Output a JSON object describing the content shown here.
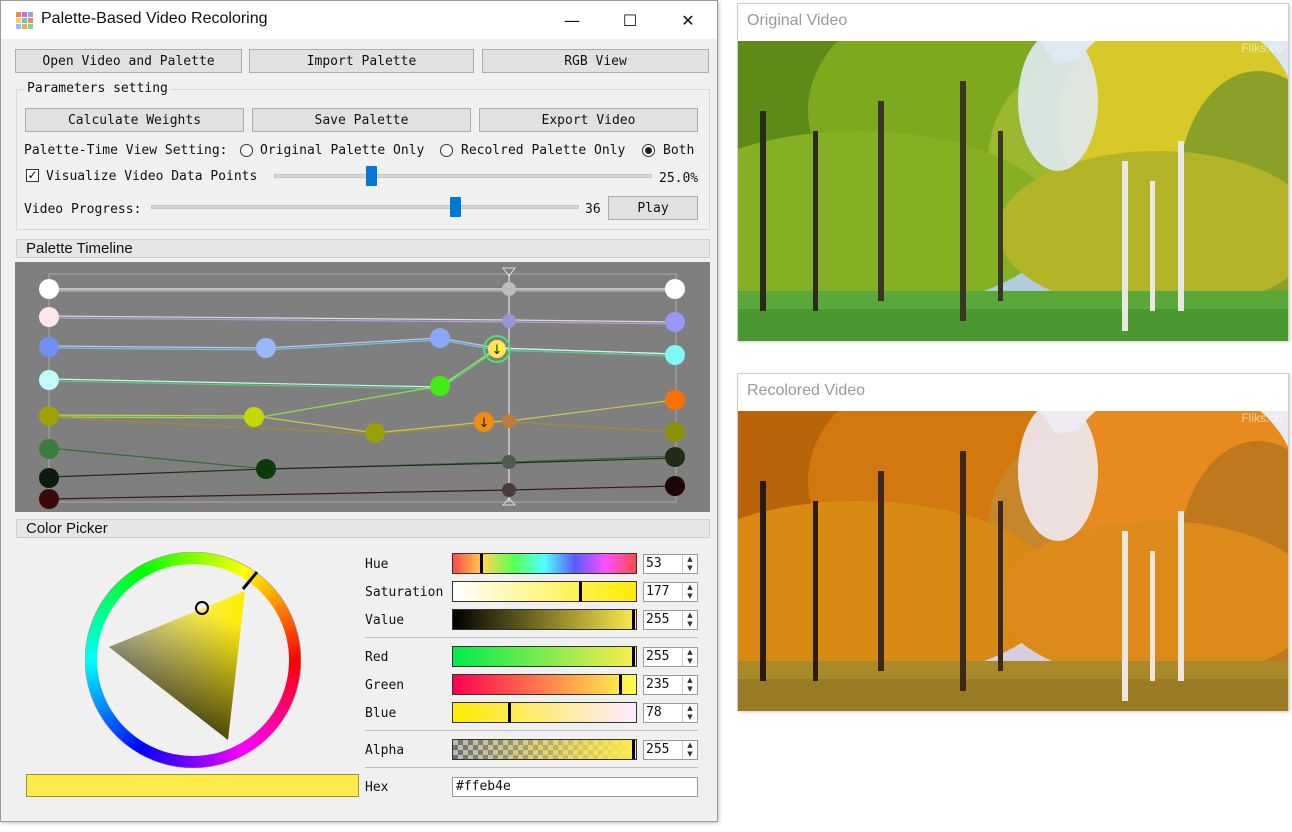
{
  "window": {
    "title": "Palette-Based Video Recoloring",
    "controls": {
      "minimize": "—",
      "maximize": "☐",
      "close": "✕"
    }
  },
  "toolbar": {
    "open_label": "Open Video and Palette",
    "import_label": "Import Palette",
    "rgb_label": "RGB View"
  },
  "params": {
    "title": "Parameters setting",
    "calc_label": "Calculate Weights",
    "save_label": "Save Palette",
    "export_label": "Export Video",
    "view_setting_label": "Palette-Time View Setting:",
    "radio_original": "Original Palette Only",
    "radio_recolored": "Recolred Palette Only",
    "radio_both": "Both",
    "selected_view": "Both",
    "visualize_label": "Visualize Video Data Points",
    "visualize_checked": true,
    "visualize_value": "25.0%",
    "visualize_fraction": 0.25,
    "progress_label": "Video Progress:",
    "progress_value": "36",
    "progress_fraction": 0.72,
    "play_label": "Play"
  },
  "timeline": {
    "title": "Palette Timeline",
    "playhead_fraction": 0.73
  },
  "picker": {
    "title": "Color Picker",
    "hue_label": "Hue",
    "hue_value": "53",
    "sat_label": "Saturation",
    "sat_value": "177",
    "val_label": "Value",
    "val_value": "255",
    "red_label": "Red",
    "red_value": "255",
    "green_label": "Green",
    "green_value": "235",
    "blue_label": "Blue",
    "blue_value": "78",
    "alpha_label": "Alpha",
    "alpha_value": "255",
    "hex_label": "Hex",
    "hex_value": "#ffeb4e",
    "current_color": "#ffeb4e"
  },
  "original_video": {
    "title": "Original Video",
    "watermark": "Fliks.co"
  },
  "recolored_video": {
    "title": "Recolored Video",
    "watermark": "Fliks.co"
  }
}
